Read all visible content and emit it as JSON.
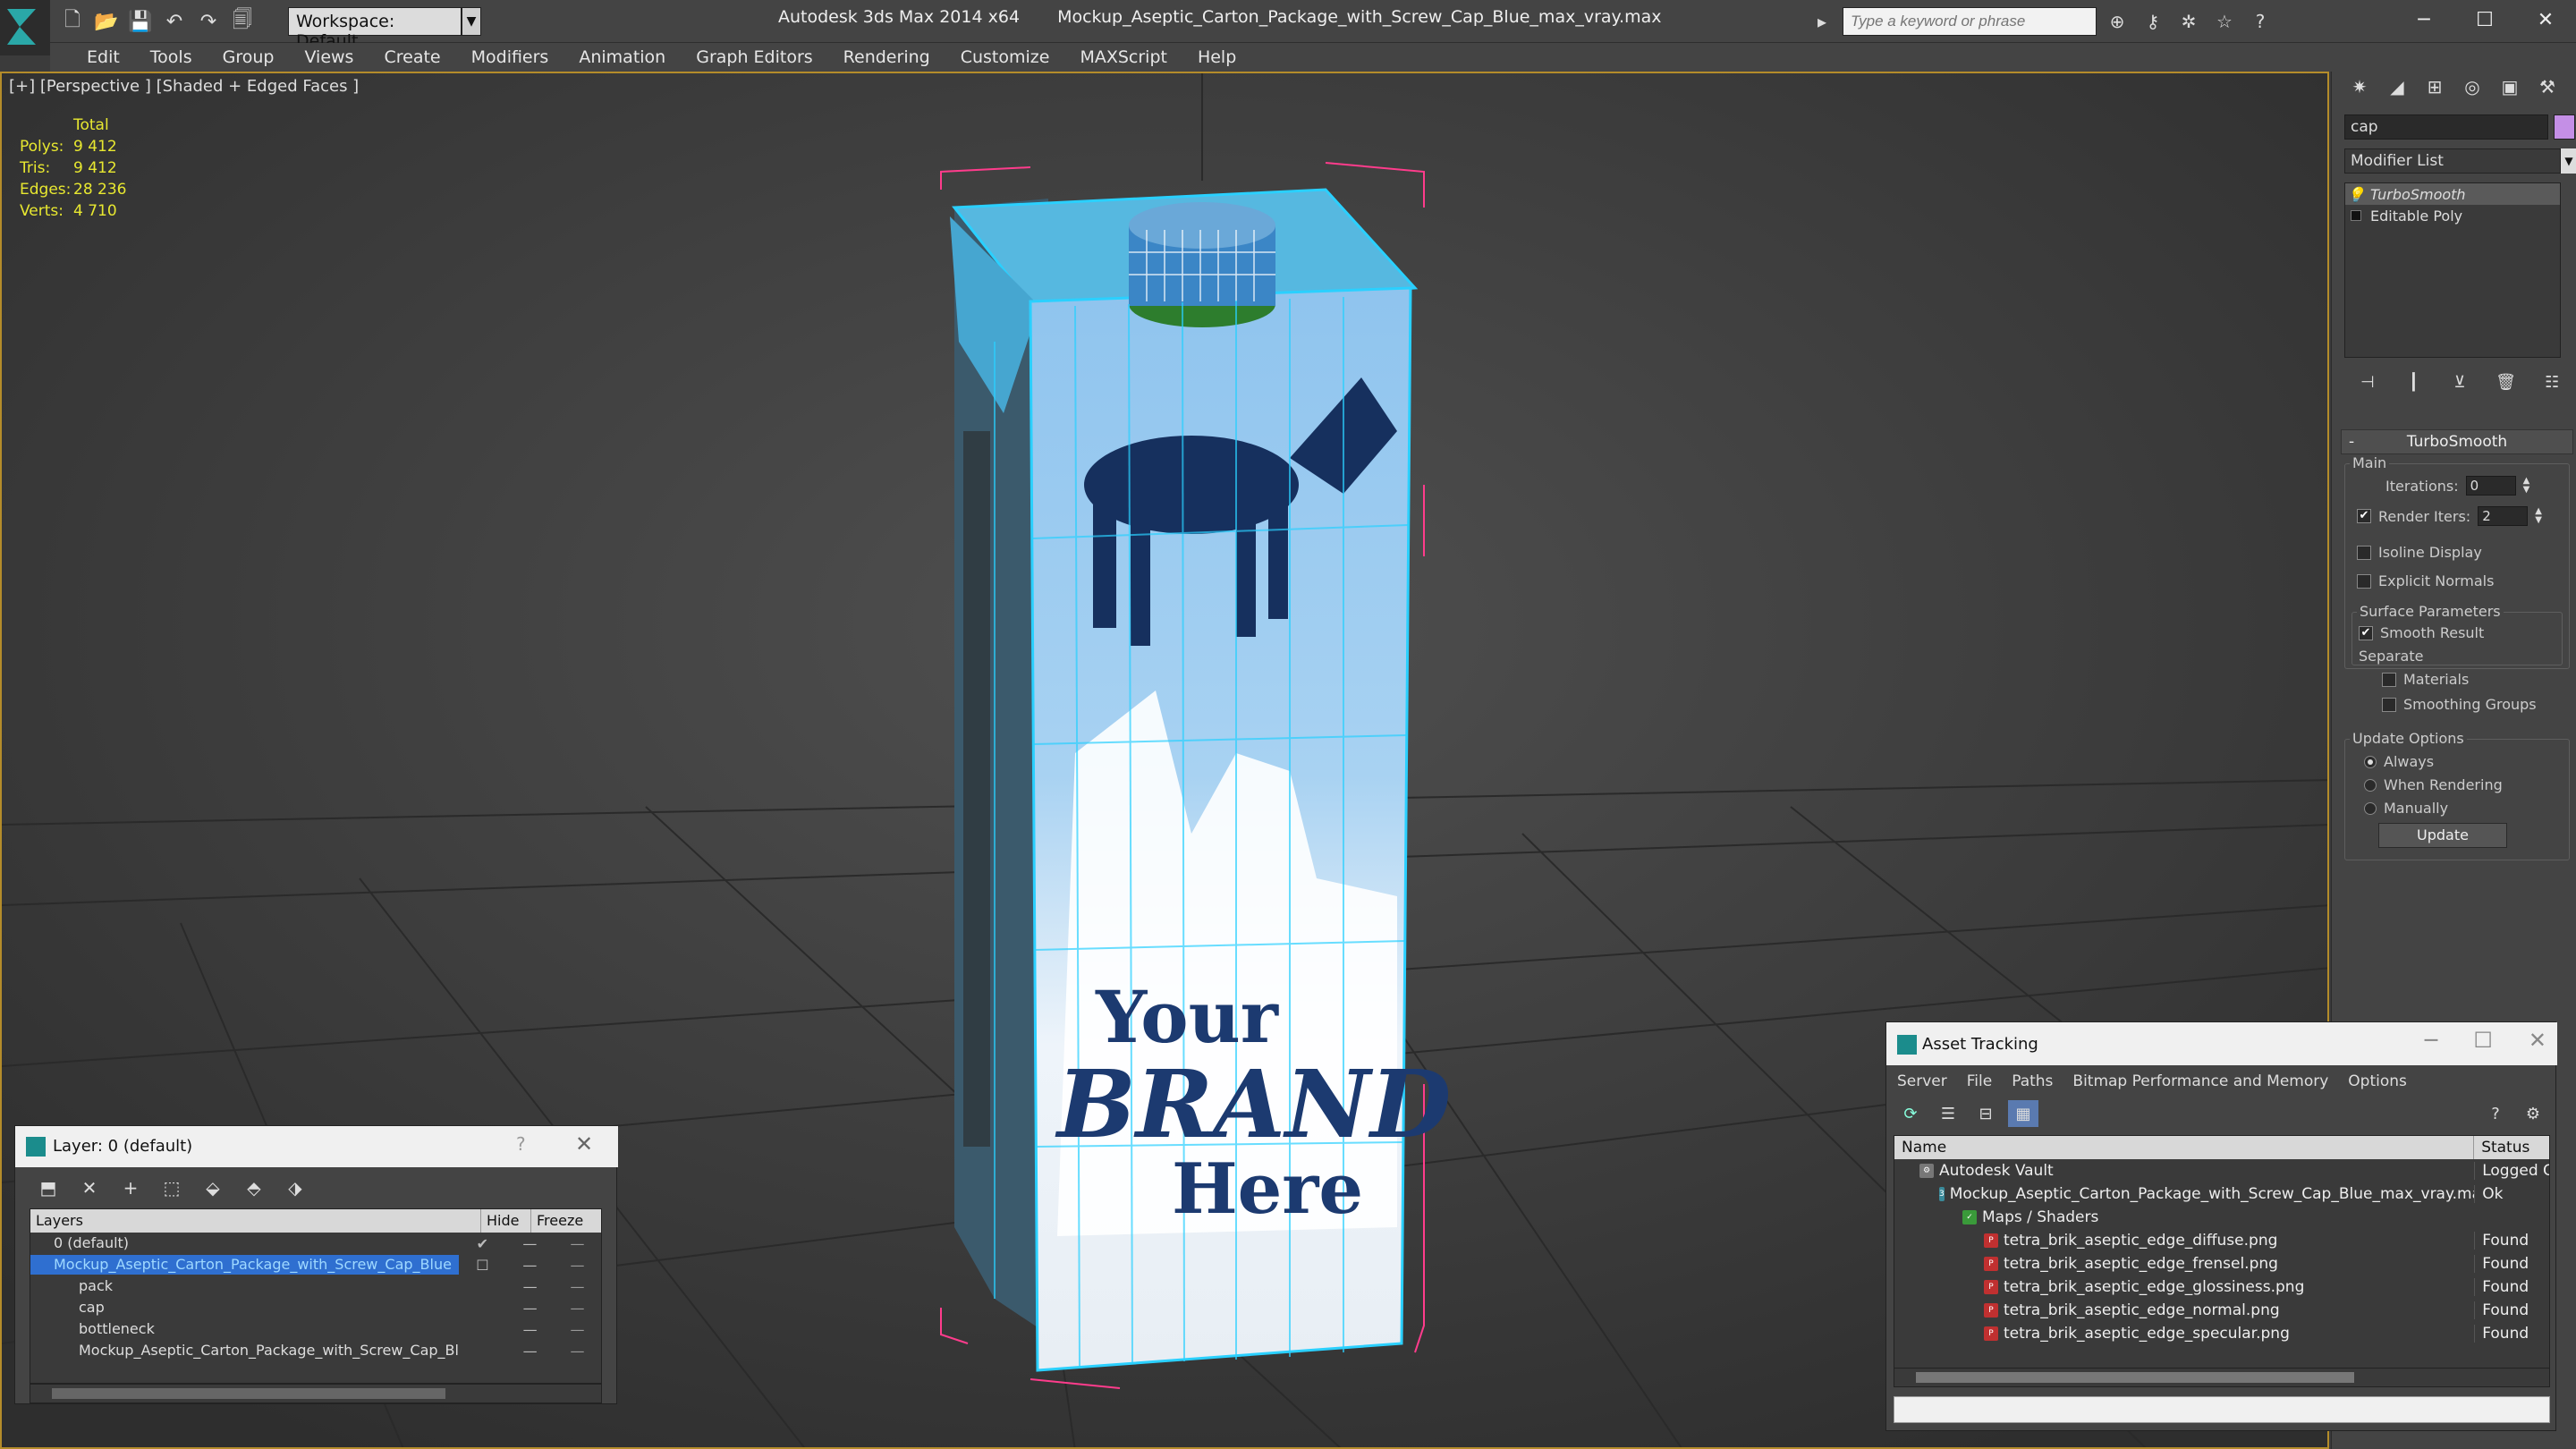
{
  "app": {
    "workspace": "Workspace: Default",
    "title": "Autodesk 3ds Max  2014 x64",
    "file": "Mockup_Aseptic_Carton_Package_with_Screw_Cap_Blue_max_vray.max",
    "search_placeholder": "Type a keyword or phrase"
  },
  "menu": [
    "Edit",
    "Tools",
    "Group",
    "Views",
    "Create",
    "Modifiers",
    "Animation",
    "Graph Editors",
    "Rendering",
    "Customize",
    "MAXScript",
    "Help"
  ],
  "viewport": {
    "label": "[+] [Perspective ] [Shaded + Edged Faces ]",
    "stats": {
      "header": "Total",
      "rows": [
        {
          "k": "Polys:",
          "v": "9 412"
        },
        {
          "k": "Tris:",
          "v": "9 412"
        },
        {
          "k": "Edges:",
          "v": "28 236"
        },
        {
          "k": "Verts:",
          "v": "4 710"
        }
      ]
    },
    "carton_text": {
      "line1": "Your",
      "line2": "BRAND",
      "line3": "Here"
    }
  },
  "command_panel": {
    "object_name": "cap",
    "modifier_list": "Modifier List",
    "stack": [
      {
        "label": "TurboSmooth"
      },
      {
        "label": "Editable Poly"
      }
    ],
    "rollout": {
      "title": "TurboSmooth",
      "main_label": "Main",
      "iterations_label": "Iterations:",
      "iterations_value": "0",
      "render_iters_label": "Render Iters:",
      "render_iters_value": "2",
      "isoline": "Isoline Display",
      "explicit_normals": "Explicit Normals",
      "surface_label": "Surface Parameters",
      "smooth_result": "Smooth Result",
      "separate_label": "Separate",
      "materials": "Materials",
      "smoothing_groups": "Smoothing Groups",
      "update_options_label": "Update Options",
      "always": "Always",
      "when_rendering": "When Rendering",
      "manually": "Manually",
      "update_button": "Update"
    }
  },
  "layer_dialog": {
    "title": "Layer: 0 (default)",
    "help": "?",
    "cols": {
      "layers": "Layers",
      "hide": "Hide",
      "freeze": "Freeze"
    },
    "rows": [
      {
        "name": "0 (default)"
      },
      {
        "name": "Mockup_Aseptic_Carton_Package_with_Screw_Cap_Blue"
      },
      {
        "name": "pack"
      },
      {
        "name": "cap"
      },
      {
        "name": "bottleneck"
      },
      {
        "name": "Mockup_Aseptic_Carton_Package_with_Screw_Cap_Blue"
      }
    ]
  },
  "asset_tracking": {
    "title": "Asset Tracking",
    "menu": [
      "Server",
      "File",
      "Paths",
      "Bitmap Performance and Memory",
      "Options"
    ],
    "cols": {
      "name": "Name",
      "status": "Status"
    },
    "rows": [
      {
        "name": "Autodesk Vault",
        "status": "Logged O"
      },
      {
        "name": "Mockup_Aseptic_Carton_Package_with_Screw_Cap_Blue_max_vray.max",
        "status": "Ok"
      },
      {
        "name": "Maps / Shaders",
        "status": ""
      },
      {
        "name": "tetra_brik_aseptic_edge_diffuse.png",
        "status": "Found"
      },
      {
        "name": "tetra_brik_aseptic_edge_frensel.png",
        "status": "Found"
      },
      {
        "name": "tetra_brik_aseptic_edge_glossiness.png",
        "status": "Found"
      },
      {
        "name": "tetra_brik_aseptic_edge_normal.png",
        "status": "Found"
      },
      {
        "name": "tetra_brik_aseptic_edge_specular.png",
        "status": "Found"
      }
    ]
  }
}
